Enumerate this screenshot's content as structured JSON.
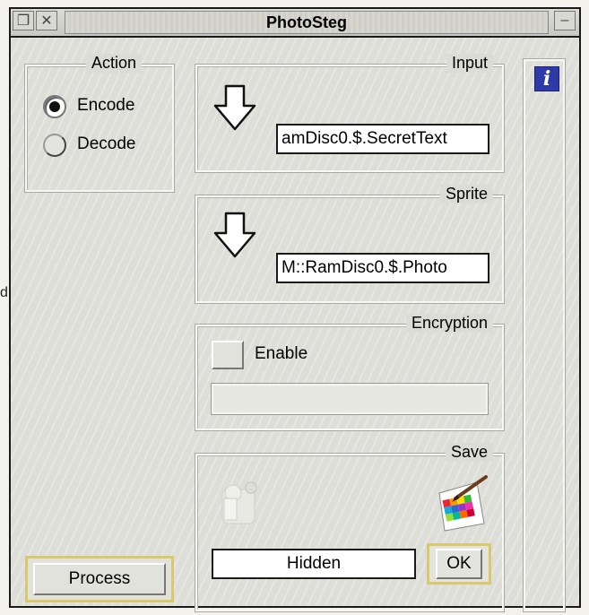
{
  "window": {
    "title": "PhotoSteg"
  },
  "action": {
    "label": "Action",
    "options": [
      {
        "label": "Encode",
        "selected": true
      },
      {
        "label": "Decode",
        "selected": false
      }
    ],
    "process_label": "Process"
  },
  "input": {
    "label": "Input",
    "path": "amDisc0.$.SecretText"
  },
  "sprite": {
    "label": "Sprite",
    "path": "M::RamDisc0.$.Photo"
  },
  "encryption": {
    "label": "Encryption",
    "enable_label": "Enable",
    "enabled": false,
    "password": ""
  },
  "save": {
    "label": "Save",
    "filename": "Hidden",
    "ok_label": "OK"
  },
  "background_text": "d"
}
